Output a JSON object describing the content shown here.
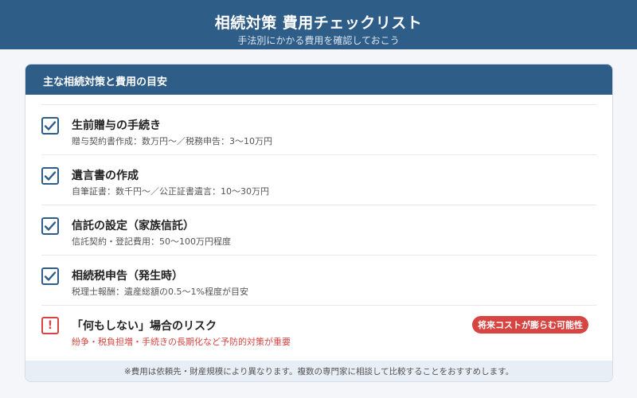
{
  "header": {
    "title": "相続対策 費用チェックリスト",
    "subtitle": "手法別にかかる費用を確認しておこう"
  },
  "card": {
    "heading": "主な相続対策と費用の目安",
    "items": [
      {
        "title": "生前贈与の手続き",
        "desc": "贈与契約書作成：数万円〜／税務申告：3〜10万円",
        "icon": "checkbox-checked-icon"
      },
      {
        "title": "遺言書の作成",
        "desc": "自筆証書：数千円〜／公正証書遺言：10〜30万円",
        "icon": "checkbox-checked-icon"
      },
      {
        "title": "信託の設定（家族信託）",
        "desc": "信託契約・登記費用：50〜100万円程度",
        "icon": "checkbox-checked-icon"
      },
      {
        "title": "相続税申告（発生時）",
        "desc": "税理士報酬：遺産総額の0.5〜1%程度が目安",
        "icon": "checkbox-checked-icon"
      }
    ],
    "risk": {
      "mark": "!",
      "title": "「何もしない」場合のリスク",
      "desc": "紛争・税負担増・手続きの長期化など予防的対策が重要",
      "badge": "将来コストが膨らむ可能性",
      "icon": "warning-icon"
    },
    "footnote": "※費用は依頼先・財産規模により異なります。複数の専門家に相談して比較することをおすすめします。"
  },
  "colors": {
    "primary": "#2e5d87",
    "danger": "#d64541",
    "background": "#f4f6f9"
  }
}
